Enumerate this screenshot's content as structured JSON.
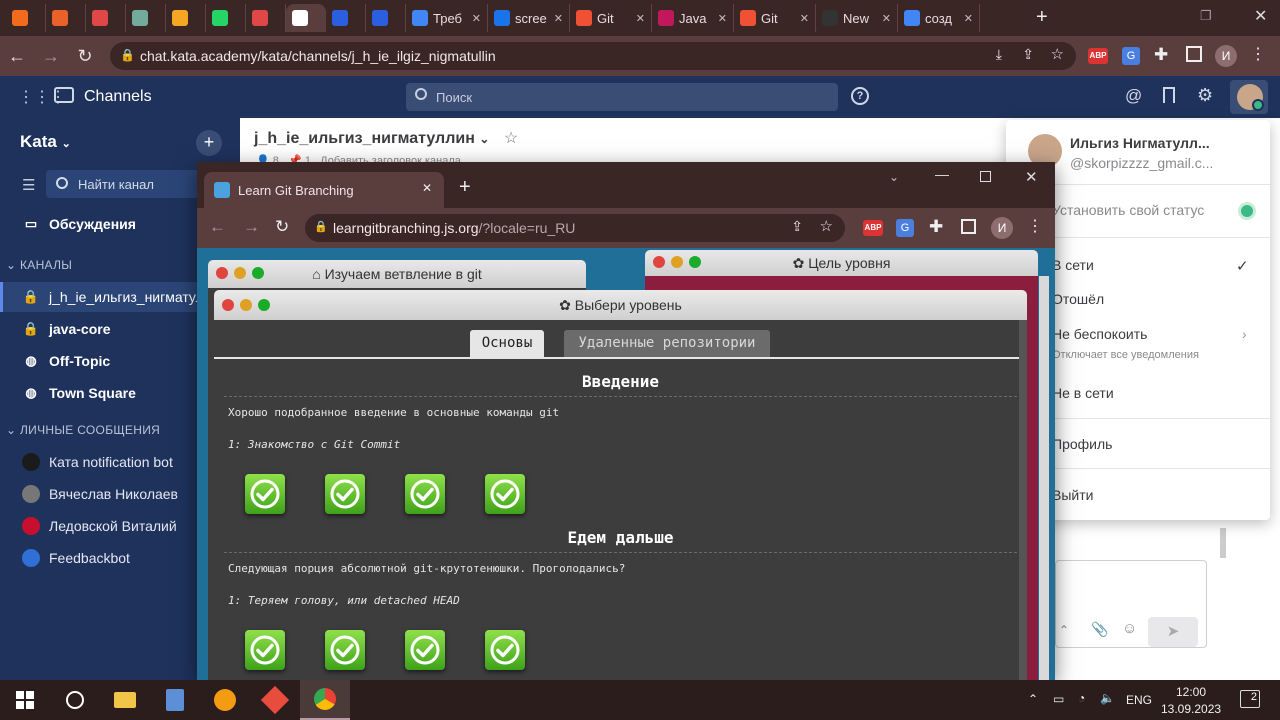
{
  "browser": {
    "tabs": [
      {
        "label": "",
        "icon": "orange-app-icon",
        "color": "#f26b1d"
      },
      {
        "label": "",
        "icon": "orange-app-icon",
        "color": "#e8622a"
      },
      {
        "label": "",
        "icon": "red-cube-icon",
        "color": "#e04747"
      },
      {
        "label": "",
        "icon": "openai-icon",
        "color": "#74aa9c"
      },
      {
        "label": "",
        "icon": "yandex-icon",
        "color": "#f5a623"
      },
      {
        "label": "",
        "icon": "whatsapp-icon",
        "color": "#25d366"
      },
      {
        "label": "",
        "icon": "abp-icon",
        "color": "#e04747"
      },
      {
        "label": "",
        "icon": "mattermost-icon",
        "color": "#ffffff"
      },
      {
        "label": "",
        "icon": "kata-icon",
        "color": "#2c5fe0"
      },
      {
        "label": "",
        "icon": "kata-icon",
        "color": "#2c5fe0"
      },
      {
        "label": "Треб",
        "icon": "docs-icon",
        "color": "#4285f4"
      },
      {
        "label": "scree",
        "icon": "screen-icon",
        "color": "#1a73e8"
      },
      {
        "label": "Git",
        "icon": "git-icon",
        "color": "#f05033"
      },
      {
        "label": "Java",
        "icon": "java-icon",
        "color": "#c2185b"
      },
      {
        "label": "Git",
        "icon": "git-icon",
        "color": "#f05033"
      },
      {
        "label": "New",
        "icon": "github-icon",
        "color": "#333333"
      },
      {
        "label": "созд",
        "icon": "google-icon",
        "color": "#4285f4"
      }
    ],
    "url": "chat.kata.academy/kata/channels/j_h_ie_ilgiz_nigmatullin",
    "profile_initial": "И"
  },
  "mattermost": {
    "app_title": "Channels",
    "search_placeholder": "Поиск",
    "team_name": "Kata",
    "find_channel": "Найти канал",
    "threads": "Обсуждения",
    "channels_header": "КАНАЛЫ",
    "channels": [
      {
        "name": "j_h_ie_ильгиз_нигматуллин",
        "icon": "lock-icon",
        "active": true
      },
      {
        "name": "java-core",
        "icon": "lock-icon",
        "active": false
      },
      {
        "name": "Off-Topic",
        "icon": "globe-icon",
        "active": false
      },
      {
        "name": "Town Square",
        "icon": "globe-icon",
        "active": false
      }
    ],
    "dm_header": "ЛИЧНЫЕ СООБЩЕНИЯ",
    "dms": [
      {
        "name": "Ката notification bot",
        "icon": "kata-bot-avatar",
        "color": "#1b1b1b"
      },
      {
        "name": "Вячеслав Николаев",
        "icon": "user-avatar",
        "color": "#777777"
      },
      {
        "name": "Ледовской Виталий",
        "icon": "user-avatar",
        "color": "#c8102e"
      },
      {
        "name": "Feedbackbot",
        "icon": "bot-avatar",
        "color": "#2f6fd6"
      }
    ],
    "channel_title": "j_h_ie_ильгиз_нигматуллин",
    "channel_members": "8",
    "channel_pinned": "1",
    "channel_header_hint": "Добавить заголовок канала"
  },
  "status_menu": {
    "user_name": "Ильгиз Нигматулл...",
    "user_email": "@skorpizzzz_gmail.c...",
    "set_status": "Установить свой статус",
    "online": "В сети",
    "away": "Отошёл",
    "dnd": "Не беспокоить",
    "dnd_hint": "Отключает все уведомления",
    "offline": "Не в сети",
    "profile": "Профиль",
    "logout": "Выйти"
  },
  "inner_browser": {
    "tab_title": "Learn Git Branching",
    "url_host": "learngitbranching.js.org",
    "url_path": "/?locale=ru_RU",
    "profile_initial": "И",
    "bg_window_left": "Изучаем ветвление в git",
    "bg_window_right": "Цель уровня",
    "level_window_title": "Выбери уровень",
    "tabs": [
      "Основы",
      "Удаленные репозитории"
    ],
    "sections": [
      {
        "title": "Введение",
        "description": "Хорошо подобранное введение в основные команды git",
        "current_level": "1: Знакомство с Git Commit",
        "levels_completed": 4
      },
      {
        "title": "Едем дальше",
        "description": "Следующая порция абсолютной git-крутотенюшки. Проголодались?",
        "current_level": "1: Теряем голову, или detached HEAD",
        "levels_completed": 4
      }
    ]
  },
  "taskbar": {
    "lang": "ENG",
    "time": "12:00",
    "date": "13.09.2023",
    "notifications": "2"
  },
  "colors": {
    "sidebar": "#1e325c",
    "accent": "#5d89ea",
    "level_complete": "#5cc51f"
  }
}
